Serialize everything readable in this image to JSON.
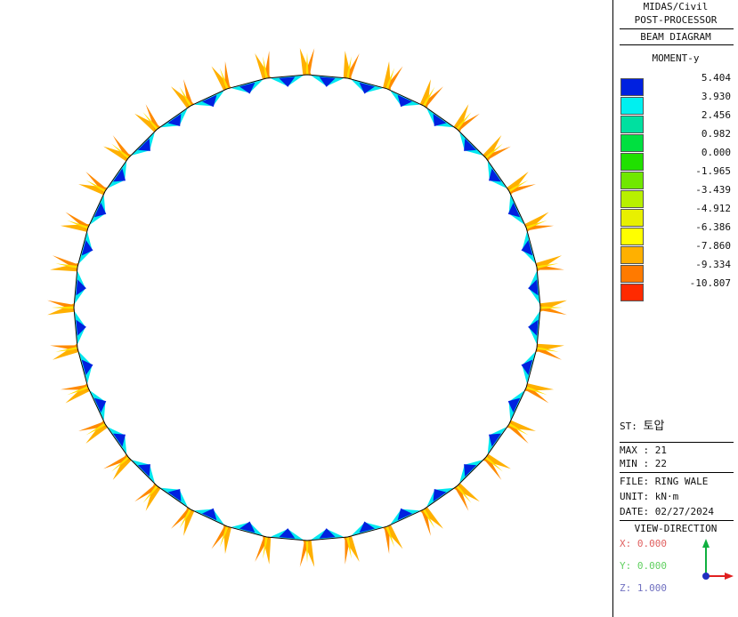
{
  "header": {
    "line1": "MIDAS/Civil",
    "line2": "POST-PROCESSOR",
    "line3": "BEAM DIAGRAM",
    "component": "MOMENT-y"
  },
  "legend": {
    "levels": [
      "5.404",
      "3.930",
      "2.456",
      "0.982",
      "0.000",
      "-1.965",
      "-3.439",
      "-4.912",
      "-6.386",
      "-7.860",
      "-9.334",
      "-10.807"
    ],
    "colors": [
      "#0020e0",
      "#00f0f0",
      "#00e0a0",
      "#00e040",
      "#20e000",
      "#70e800",
      "#b8f000",
      "#e8f000",
      "#ffff00",
      "#ffb000",
      "#ff7a00",
      "#ff2a00"
    ]
  },
  "info": {
    "st_label": "ST:",
    "st_value": "토압",
    "max": "MAX : 21",
    "min": "MIN : 22",
    "file": "FILE: RING WALE",
    "unit": "UNIT: kN·m",
    "date": "DATE: 02/27/2024"
  },
  "view": {
    "title": "VIEW-DIRECTION",
    "x": "X: 0.000",
    "y": "Y: 0.000",
    "z": "Z: 1.000",
    "x_color": "#e06060",
    "y_color": "#60d060",
    "z_color": "#7070c0"
  },
  "diagram": {
    "segments": 36
  }
}
